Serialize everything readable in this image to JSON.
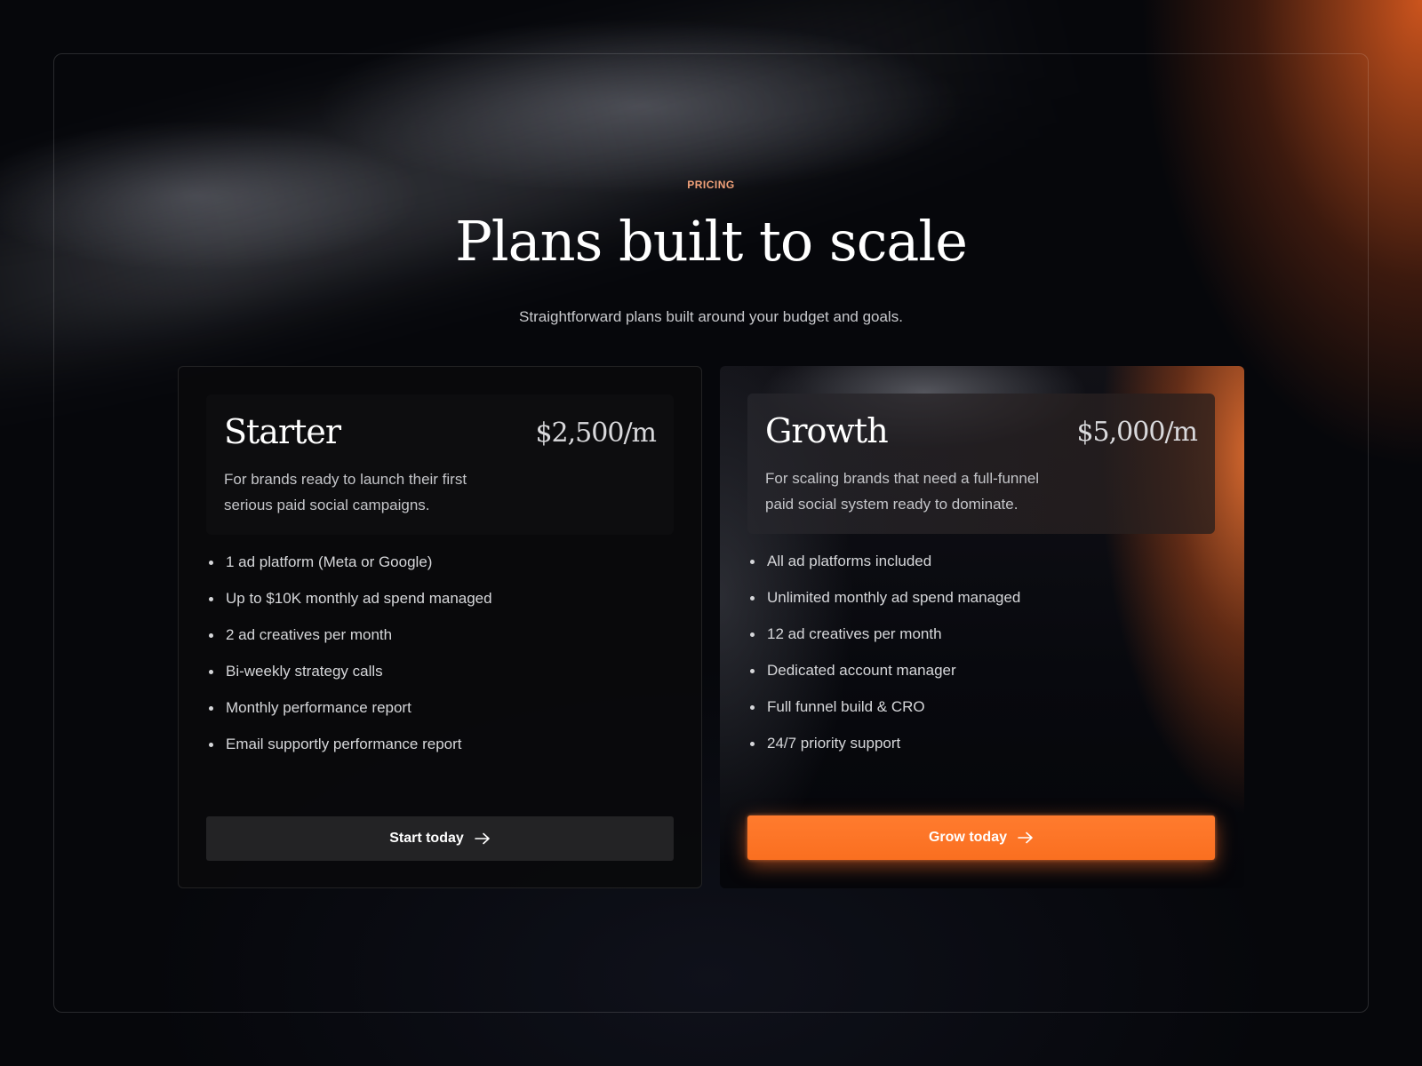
{
  "section": {
    "eyebrow": "PRICING",
    "title": "Plans built to scale",
    "subtitle": "Straightforward plans built around your budget and goals."
  },
  "plans": [
    {
      "name": "Starter",
      "price": "$2,500/m",
      "description": "For brands ready to launch their first serious paid social campaigns.",
      "features": [
        "1 ad platform (Meta or Google)",
        "Up to $10K monthly ad spend managed",
        "2 ad creatives per month",
        "Bi-weekly strategy calls",
        "Monthly performance report",
        "Email supportly performance report"
      ],
      "cta": "Start today",
      "cta_icon": "arrow-right-icon"
    },
    {
      "name": "Growth",
      "price": "$5,000/m",
      "description": "For scaling brands that need a full-funnel paid social system ready to dominate.",
      "features": [
        "All ad platforms included",
        "Unlimited monthly ad spend managed",
        "12 ad creatives per month",
        "Dedicated account manager",
        "Full funnel build & CRO",
        "24/7 priority support"
      ],
      "cta": "Grow today",
      "cta_icon": "arrow-right-icon"
    }
  ],
  "colors": {
    "accent": "#FA6F20",
    "eyebrow": "#F2A27A",
    "background": "#06070B",
    "dark_button": "#232325"
  }
}
